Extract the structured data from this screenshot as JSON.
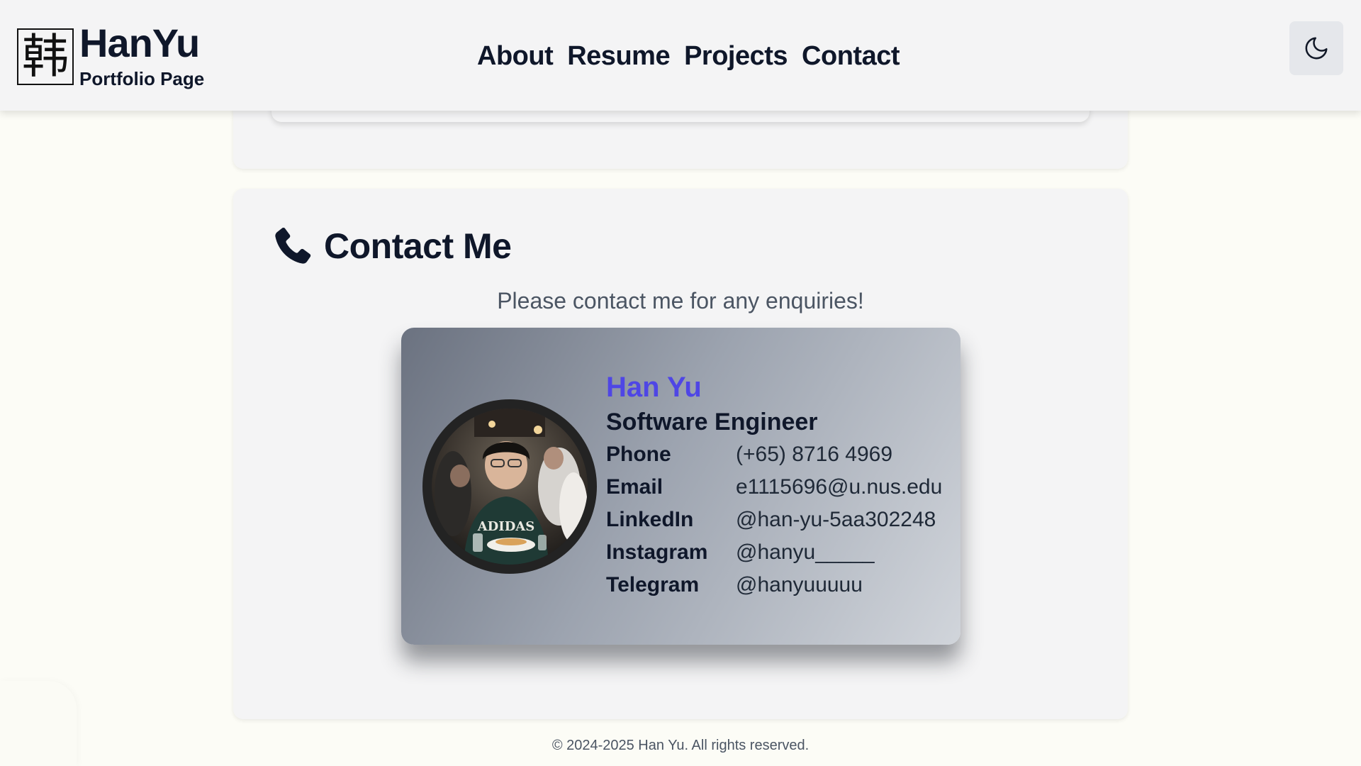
{
  "brand": {
    "logo_char": "韩",
    "name": "HanYu",
    "subtitle": "Portfolio Page"
  },
  "nav": {
    "links": [
      "About",
      "Resume",
      "Projects",
      "Contact"
    ]
  },
  "theme_toggle": {
    "icon": "moon-icon"
  },
  "contact": {
    "title": "Contact Me",
    "icon": "phone-icon",
    "subtitle": "Please contact me for any enquiries!",
    "card": {
      "name": "Han Yu",
      "role": "Software Engineer",
      "rows": [
        {
          "label": "Phone",
          "value": "(+65) 8716 4969"
        },
        {
          "label": "Email",
          "value": "e1115696@u.nus.edu"
        },
        {
          "label": "LinkedIn",
          "value": "@han-yu-5aa302248"
        },
        {
          "label": "Instagram",
          "value": "@hanyu_____"
        },
        {
          "label": "Telegram",
          "value": "@hanyuuuuu"
        }
      ],
      "shirt_text": "ADIDAS"
    }
  },
  "footer": {
    "text": "© 2024-2025 Han Yu. All rights reserved."
  },
  "colors": {
    "accent_name": "#4f46e5",
    "page_bg": "#fcfcf6",
    "panel_bg": "#f4f4f5"
  }
}
